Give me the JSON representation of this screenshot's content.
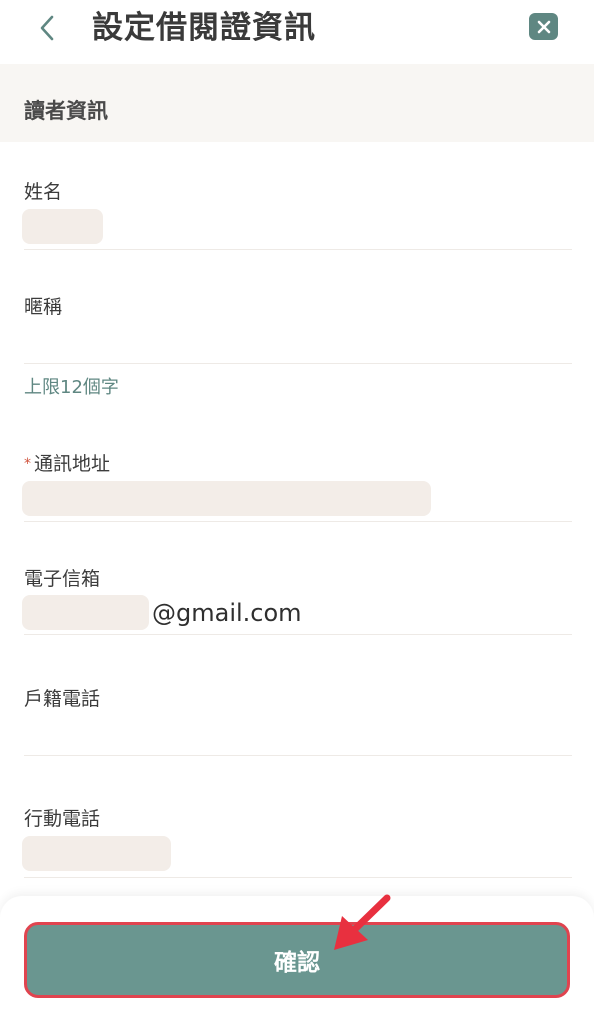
{
  "header": {
    "back_icon": "chevron-left-icon",
    "title": "設定借閱證資訊",
    "close_icon": "close-icon"
  },
  "section": {
    "title": "讀者資訊"
  },
  "fields": {
    "name": {
      "label": "姓名"
    },
    "nickname": {
      "label": "暱稱",
      "hint": "上限12個字"
    },
    "address": {
      "required_mark": "*",
      "label": "通訊地址"
    },
    "email": {
      "label": "電子信箱",
      "suffix": "@gmail.com"
    },
    "home_phone": {
      "label": "戶籍電話"
    },
    "mobile": {
      "label": "行動電話"
    }
  },
  "actions": {
    "confirm_label": "確認"
  },
  "colors": {
    "accent": "#6a9690",
    "icon_bg": "#5f8782",
    "highlight": "#e0444f",
    "redacted": "#f3ede8"
  }
}
